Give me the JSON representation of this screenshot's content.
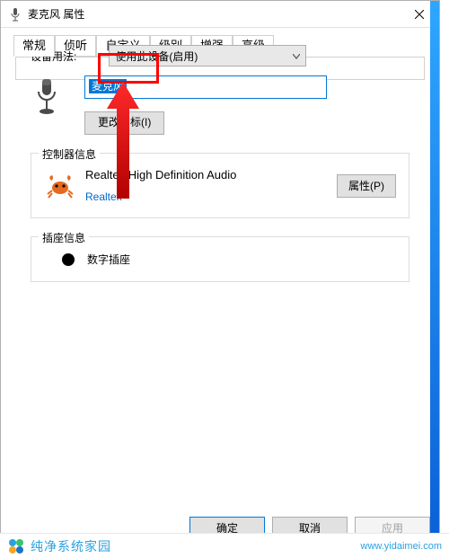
{
  "title": "麦克风 属性",
  "tabs": {
    "general": "常规",
    "listen": "侦听",
    "custom": "自定义",
    "levels": "级别",
    "enhance": "增强",
    "advanced": "高级"
  },
  "name_field": {
    "value": "麦克风"
  },
  "change_icon_btn": "更改图标(I)",
  "controller": {
    "group_title": "控制器信息",
    "device": "Realtek High Definition Audio",
    "vendor": "Realtek",
    "properties_btn": "属性(P)"
  },
  "jack": {
    "group_title": "插座信息",
    "label": "数字插座"
  },
  "usage": {
    "label": "设备用法:",
    "selected": "使用此设备(启用)"
  },
  "buttons": {
    "ok": "确定",
    "cancel": "取消",
    "apply": "应用"
  },
  "footer": {
    "brand": "纯净系统家园",
    "url": "www.yidaimei.com"
  }
}
